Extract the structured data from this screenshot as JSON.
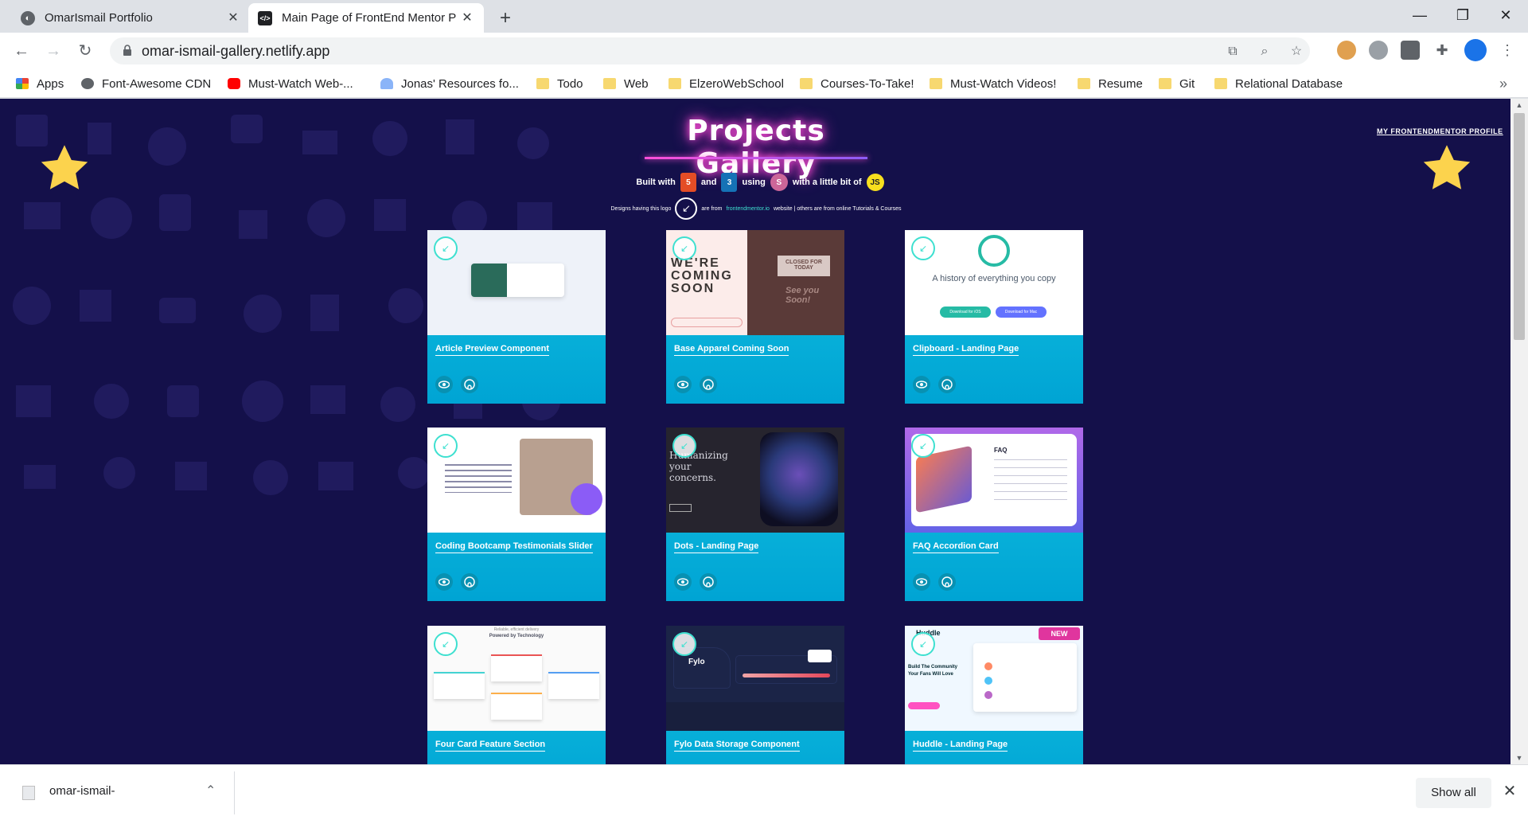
{
  "browser": {
    "tabs": [
      {
        "title": "OmarIsmail Portfolio",
        "active": false
      },
      {
        "title": "Main Page of FrontEnd Mentor P",
        "active": true
      }
    ],
    "url": "omar-ismail-gallery.netlify.app",
    "bookmarks": [
      {
        "label": "Apps",
        "icon": "apps-grid-icon"
      },
      {
        "label": "Font-Awesome CDN",
        "icon": "globe-icon"
      },
      {
        "label": "Must-Watch Web-...",
        "icon": "youtube-icon"
      },
      {
        "label": "Jonas' Resources fo...",
        "icon": "heart-icon"
      },
      {
        "label": "Todo",
        "icon": "folder-icon"
      },
      {
        "label": "Web",
        "icon": "folder-icon"
      },
      {
        "label": "ElzeroWebSchool",
        "icon": "folder-icon"
      },
      {
        "label": "Courses-To-Take!",
        "icon": "folder-icon"
      },
      {
        "label": "Must-Watch Videos!",
        "icon": "folder-icon"
      },
      {
        "label": "Resume",
        "icon": "folder-icon"
      },
      {
        "label": "Git",
        "icon": "folder-icon"
      },
      {
        "label": "Relational Database",
        "icon": "folder-icon"
      }
    ],
    "bookmarks_overflow": "»"
  },
  "page": {
    "heading": "Projects Gallery",
    "built_with": {
      "prefix": "Built with",
      "and": "and",
      "using": "using",
      "suffix": "with a little bit of",
      "html": "5",
      "css": "3",
      "js": "JS"
    },
    "note": {
      "part1": "Designs having this logo",
      "part2": "are from",
      "link": "frontendmentor.io",
      "part3": "website | others are from online Tutorials & Courses"
    },
    "profile_link": "MY FRONTENDMENTOR PROFILE",
    "projects": [
      {
        "title": "Article Preview Component"
      },
      {
        "title": "Base Apparel Coming Soon"
      },
      {
        "title": "Clipboard - Landing Page"
      },
      {
        "title": "Coding Bootcamp Testimonials Slider"
      },
      {
        "title": "Dots - Landing Page"
      },
      {
        "title": "FAQ Accordion Card"
      },
      {
        "title": "Four Card Feature Section"
      },
      {
        "title": "Fylo Data Storage Component"
      },
      {
        "title": "Huddle - Landing Page"
      }
    ],
    "thumb_text": {
      "coming_soon": "WE'RE COMING SOON",
      "closed": "CLOSED FOR TODAY",
      "see_you": "See you Soon!",
      "clipboard_heading": "A history of everything you copy",
      "ios": "Download for iOS",
      "mac": "Download for Mac",
      "dots_heading": "Humanizing your concerns.",
      "faq": "FAQ",
      "fylo": "Fylo",
      "huddle": "Huddle",
      "huddle_sub": "Build The Community Your Fans Will Love",
      "new_badge": "NEW",
      "fourcard_top": "Reliable, efficient delivery",
      "fourcard_sub": "Powered by Technology"
    }
  },
  "downloads": {
    "file": "omar-ismail-",
    "show_all": "Show all"
  },
  "colors": {
    "page_bg": "#14104a",
    "card": "#06b6d4",
    "neon": "#ff4fd8",
    "star": "#fcd34d"
  }
}
